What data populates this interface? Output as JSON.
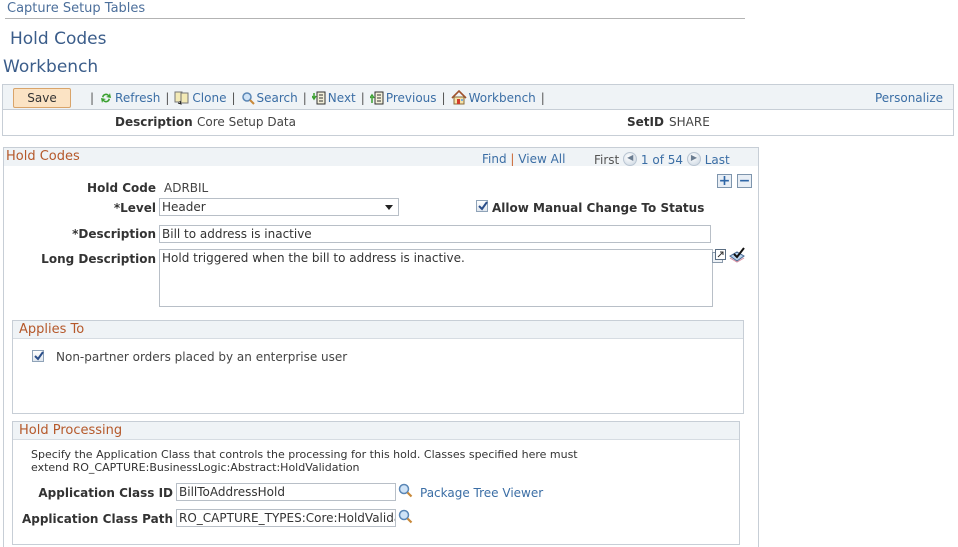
{
  "breadcrumb": "Capture Setup Tables",
  "page_title": "Hold Codes",
  "sub_title": "Workbench",
  "toolbar": {
    "save_label": "Save",
    "items": [
      {
        "label": "Refresh",
        "icon": "refresh-icon"
      },
      {
        "label": "Clone",
        "icon": "clone-icon"
      },
      {
        "label": "Search",
        "icon": "search-icon"
      },
      {
        "label": "Next",
        "icon": "next-icon"
      },
      {
        "label": "Previous",
        "icon": "previous-icon"
      },
      {
        "label": "Workbench",
        "icon": "home-icon"
      }
    ],
    "separator": "|",
    "personalize_label": "Personalize"
  },
  "keybar": {
    "description_label": "Description",
    "description_value": "Core Setup Data",
    "setid_label": "SetID",
    "setid_value": "SHARE"
  },
  "hold_codes": {
    "title": "Hold Codes",
    "nav": {
      "find": "Find",
      "sep": "|",
      "view_all": "View All",
      "first": "First",
      "position": "1 of 54",
      "last": "Last"
    },
    "add_label": "+",
    "remove_label": "−",
    "hold_code_label": "Hold Code",
    "hold_code_value": "ADRBIL",
    "level_label": "*Level",
    "level_value": "Header",
    "allow_manual_label": "Allow Manual Change To Status",
    "allow_manual_checked": true,
    "description_label": "*Description",
    "description_value": "Bill to address is inactive",
    "long_description_label": "Long Description",
    "long_description_value": "Hold triggered when the bill to address is inactive."
  },
  "applies_to": {
    "title": "Applies To",
    "option_label": "Non-partner orders placed by an enterprise user",
    "option_checked": true
  },
  "hold_processing": {
    "title": "Hold Processing",
    "help_line1": "Specify the Application Class that controls the processing for this hold. Classes specified here must",
    "help_line2": "extend RO_CAPTURE:BusinessLogic:Abstract:HoldValidation",
    "class_id_label": "Application Class ID",
    "class_id_value": "BillToAddressHold",
    "package_tree_label": "Package Tree Viewer",
    "class_path_label": "Application Class Path",
    "class_path_value": "RO_CAPTURE_TYPES:Core:HoldValidation"
  },
  "colors": {
    "link": "#3b6ea5",
    "section_title": "#b5582a",
    "header_bg": "#eff3f6",
    "save_bg": "#fbe3c4"
  }
}
